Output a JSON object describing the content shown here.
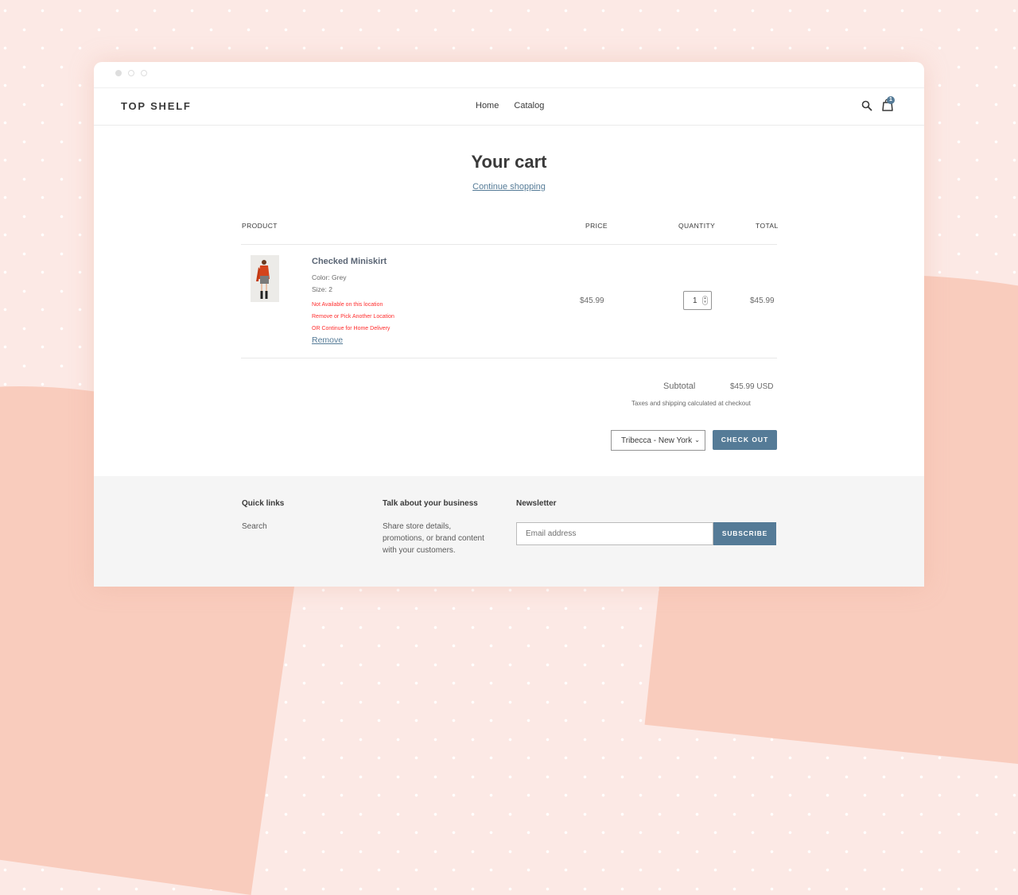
{
  "store": {
    "name": "TOP SHELF"
  },
  "nav": {
    "items": [
      {
        "label": "Home"
      },
      {
        "label": "Catalog"
      }
    ]
  },
  "header": {
    "cart_count": "1"
  },
  "cart": {
    "title": "Your cart",
    "continue_link": "Continue shopping",
    "columns": {
      "product": "PRODUCT",
      "price": "PRICE",
      "quantity": "QUANTITY",
      "total": "TOTAL"
    },
    "items": [
      {
        "name": "Checked Miniskirt",
        "color": "Color: Grey",
        "size": "Size: 2",
        "warnings": [
          "Not Available on this location",
          "Remove or Pick Another Location",
          "OR Continue for Home Delivery"
        ],
        "remove_label": "Remove",
        "price": "$45.99",
        "quantity": "1",
        "total": "$45.99"
      }
    ],
    "subtotal_label": "Subtotal",
    "subtotal_value": "$45.99 USD",
    "taxes_note": "Taxes and shipping calculated at checkout",
    "location_selected": "Tribecca - New York",
    "checkout_label": "CHECK OUT"
  },
  "footer": {
    "quick_links": {
      "heading": "Quick links",
      "links": [
        "Search"
      ]
    },
    "business": {
      "heading": "Talk about your business",
      "lines": [
        "Share store details,",
        "promotions, or brand content",
        "with your customers."
      ]
    },
    "newsletter": {
      "heading": "Newsletter",
      "placeholder": "Email address",
      "button": "SUBSCRIBE"
    }
  },
  "colors": {
    "accent": "#557b97",
    "warning": "#ff2e2e",
    "background": "#fce9e5",
    "blob": "#f9ccbd"
  }
}
